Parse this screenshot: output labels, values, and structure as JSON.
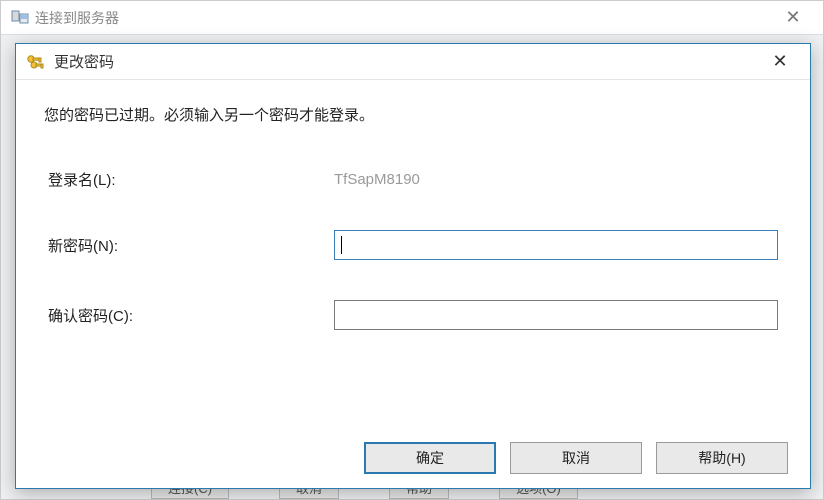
{
  "outer": {
    "title": "连接到服务器",
    "close_label": "✕",
    "bottom_tabs": [
      "连接(C)",
      "取消",
      "帮助",
      "选项(O)"
    ]
  },
  "dialog": {
    "title": "更改密码",
    "close_label": "✕",
    "message": "您的密码已过期。必须输入另一个密码才能登录。",
    "login": {
      "label": "登录名(L):",
      "value": "TfSapM8190"
    },
    "new_password": {
      "label": "新密码(N):",
      "value": ""
    },
    "confirm_password": {
      "label": "确认密码(C):",
      "value": ""
    },
    "buttons": {
      "ok": "确定",
      "cancel": "取消",
      "help": "帮助(H)"
    }
  }
}
